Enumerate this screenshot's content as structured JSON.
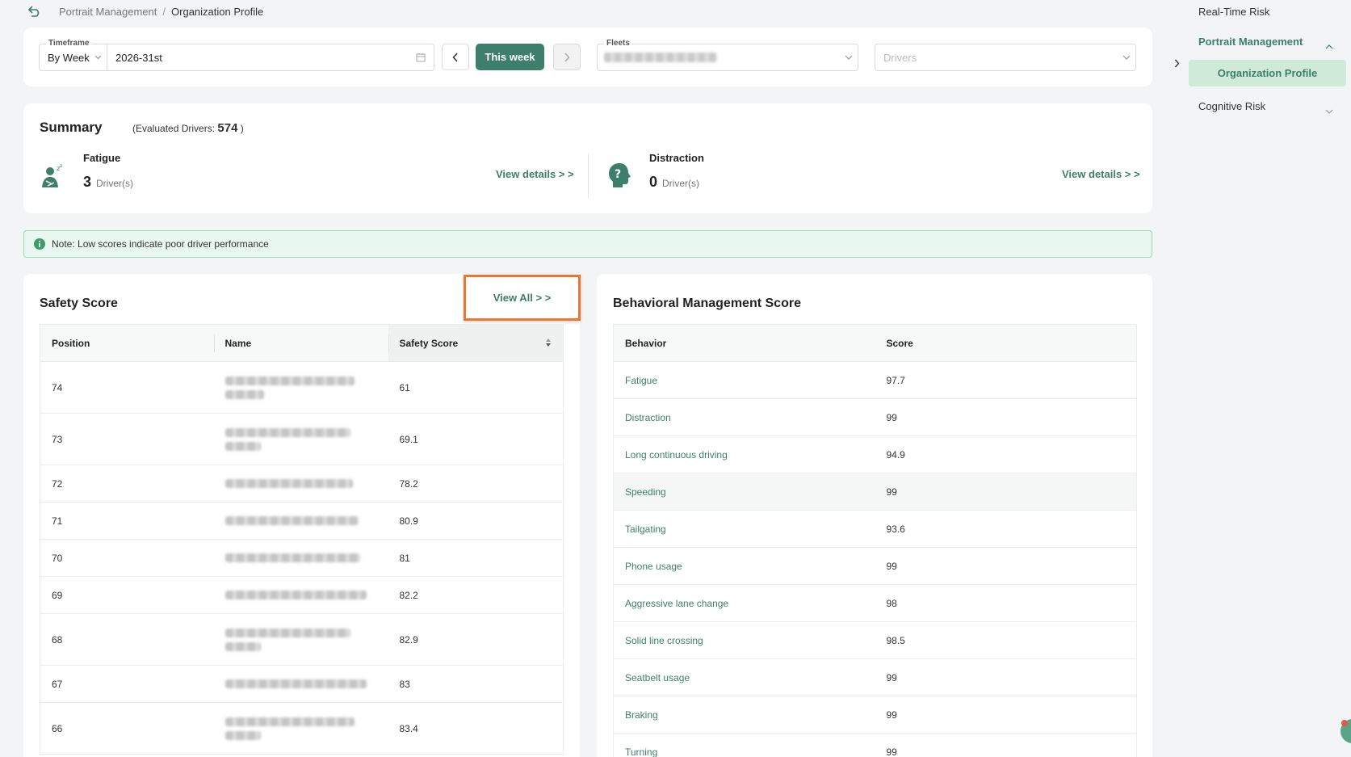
{
  "breadcrumb": {
    "parent": "Portrait Management",
    "separator": "/",
    "current": "Organization Profile"
  },
  "filters": {
    "timeframe_label": "Timeframe",
    "timeframe_mode": "By Week",
    "timeframe_value": "2026-31st",
    "this_week": "This week",
    "fleets_label": "Fleets",
    "drivers_placeholder": "Drivers"
  },
  "summary": {
    "title": "Summary",
    "evaluated_prefix": "(Evaluated Drivers:",
    "evaluated_count": "574",
    "evaluated_suffix": ")",
    "fatigue": {
      "label": "Fatigue",
      "count": "3",
      "unit": "Driver(s)",
      "link": "View details > >"
    },
    "distraction": {
      "label": "Distraction",
      "count": "0",
      "unit": "Driver(s)",
      "link": "View details > >"
    }
  },
  "note": "Note: Low scores indicate poor driver performance",
  "safety": {
    "title": "Safety Score",
    "view_all": "View All > >",
    "columns": [
      "Position",
      "Name",
      "Safety Score"
    ],
    "rows": [
      {
        "position": "74",
        "score": "61"
      },
      {
        "position": "73",
        "score": "69.1"
      },
      {
        "position": "72",
        "score": "78.2"
      },
      {
        "position": "71",
        "score": "80.9"
      },
      {
        "position": "70",
        "score": "81"
      },
      {
        "position": "69",
        "score": "82.2"
      },
      {
        "position": "68",
        "score": "82.9"
      },
      {
        "position": "67",
        "score": "83"
      },
      {
        "position": "66",
        "score": "83.4"
      }
    ]
  },
  "behavior": {
    "title": "Behavioral Management Score",
    "columns": [
      "Behavior",
      "Score"
    ],
    "rows": [
      {
        "name": "Fatigue",
        "score": "97.7"
      },
      {
        "name": "Distraction",
        "score": "99"
      },
      {
        "name": "Long continuous driving",
        "score": "94.9"
      },
      {
        "name": "Speeding",
        "score": "99"
      },
      {
        "name": "Tailgating",
        "score": "93.6"
      },
      {
        "name": "Phone usage",
        "score": "99"
      },
      {
        "name": "Aggressive lane change",
        "score": "98"
      },
      {
        "name": "Solid line crossing",
        "score": "98.5"
      },
      {
        "name": "Seatbelt usage",
        "score": "99"
      },
      {
        "name": "Braking",
        "score": "99"
      },
      {
        "name": "Turning",
        "score": "99"
      }
    ]
  },
  "sidebar": {
    "real_time": "Real-Time Risk",
    "portrait": "Portrait Management",
    "org_profile": "Organization Profile",
    "cognitive": "Cognitive Risk"
  },
  "colors": {
    "accent": "#3d7f6a",
    "highlight": "#e87734",
    "note_bg": "#e8f7ef"
  }
}
